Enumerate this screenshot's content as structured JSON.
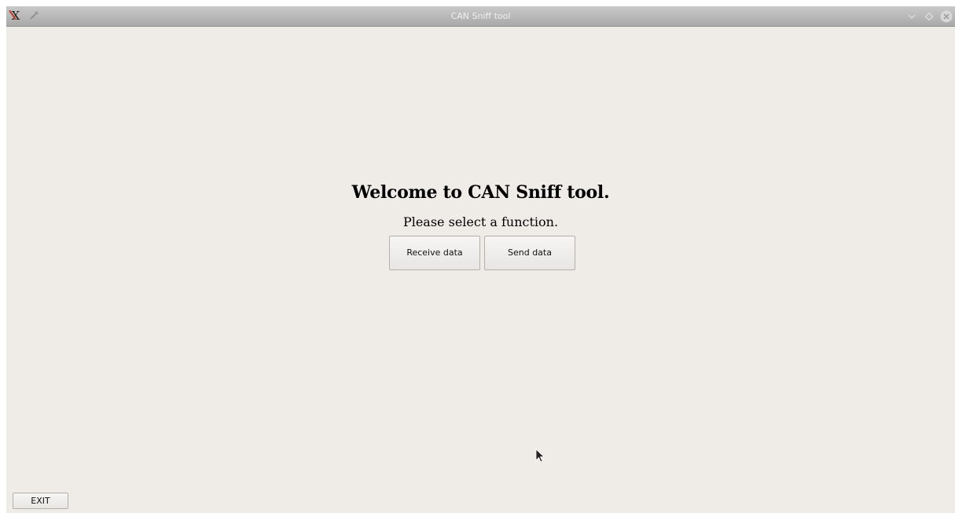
{
  "window": {
    "title": "CAN Sniff tool"
  },
  "titlebar": {
    "icons": {
      "app": "app-icon",
      "pin": "pin-icon",
      "minimize": "chevron-down-icon",
      "maximize": "diamond-icon",
      "close": "close-icon"
    }
  },
  "main": {
    "welcome": "Welcome to CAN Sniff tool.",
    "prompt": "Please select a function.",
    "buttons": {
      "receive": "Receive data",
      "send": "Send data"
    }
  },
  "footer": {
    "exit": "EXIT"
  },
  "colors": {
    "window_bg": "#efebe7",
    "titlebar": "#b8b8b8",
    "title_text": "#f0f0f0"
  }
}
